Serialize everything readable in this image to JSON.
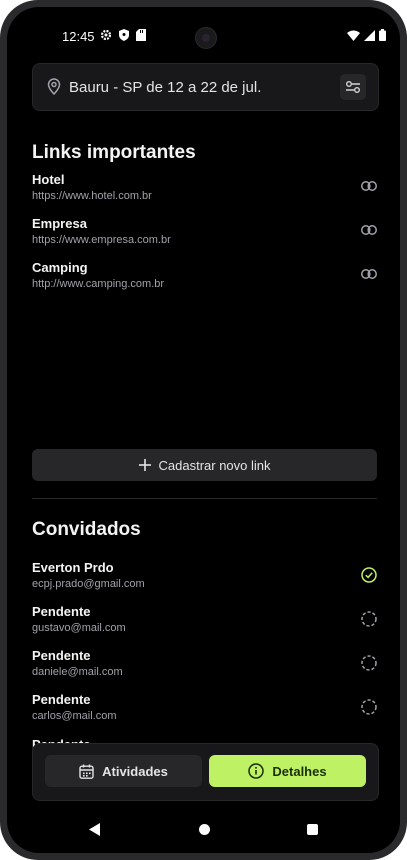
{
  "status_bar": {
    "time": "12:45"
  },
  "header": {
    "location": "Bauru - SP de 12 a 22 de jul."
  },
  "links_section": {
    "title": "Links importantes",
    "items": [
      {
        "title": "Hotel",
        "url": "https://www.hotel.com.br"
      },
      {
        "title": "Empresa",
        "url": "https://www.empresa.com.br"
      },
      {
        "title": "Camping",
        "url": "http://www.camping.com.br"
      }
    ],
    "add_button_label": "Cadastrar novo link"
  },
  "guests_section": {
    "title": "Convidados",
    "items": [
      {
        "name": "Everton Prdo",
        "email": "ecpj.prado@gmail.com",
        "confirmed": true
      },
      {
        "name": "Pendente",
        "email": "gustavo@mail.com",
        "confirmed": false
      },
      {
        "name": "Pendente",
        "email": "daniele@mail.com",
        "confirmed": false
      },
      {
        "name": "Pendente",
        "email": "carlos@mail.com",
        "confirmed": false
      }
    ],
    "partial_item_name": "Pendente"
  },
  "tabs": {
    "activities_label": "Atividades",
    "details_label": "Detalhes"
  },
  "colors": {
    "accent": "#bef264",
    "background": "#000000",
    "card": "#18181b",
    "muted_text": "#a1a1aa"
  },
  "icons": {
    "location": "map-pin-icon",
    "settings": "sliders-icon",
    "link": "link-icon",
    "add": "plus-icon",
    "confirmed": "check-circle-icon",
    "pending": "dashed-circle-icon",
    "activities": "calendar-icon",
    "details": "info-icon"
  }
}
